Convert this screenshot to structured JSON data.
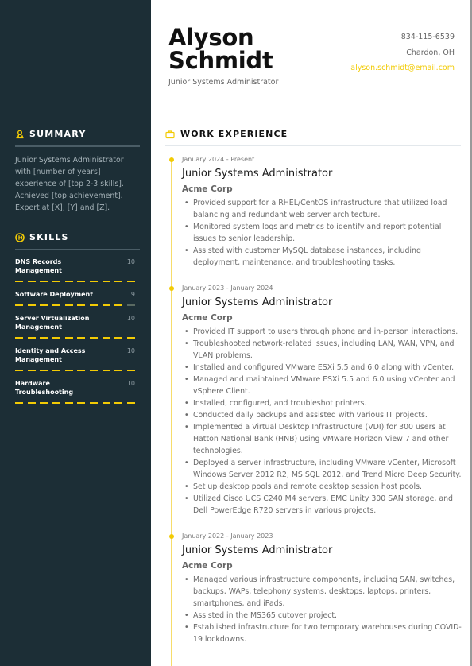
{
  "header": {
    "first_name": "Alyson",
    "last_name": "Schmidt",
    "headline": "Junior Systems Administrator",
    "phone": "834-115-6539",
    "location": "Chardon, OH",
    "email": "alyson.schmidt@email.com"
  },
  "colors": {
    "accent": "#f2cb05",
    "sidebar_bg": "#1c2e36"
  },
  "summary": {
    "title": "SUMMARY",
    "icon": "user-icon",
    "text": "Junior Systems Administrator with [number of years] experience of [top 2-3 skills]. Achieved [top achievement]. Expert at [X], [Y] and [Z]."
  },
  "skills": {
    "title": "SKILLS",
    "icon": "skills-badge-icon",
    "max": 10,
    "items": [
      {
        "name": "DNS Records Management",
        "score": "10",
        "value": 10
      },
      {
        "name": "Software Deployment",
        "score": "9",
        "value": 9
      },
      {
        "name": "Server Virtualization Management",
        "score": "10",
        "value": 10
      },
      {
        "name": "Identity and Access Management",
        "score": "10",
        "value": 10
      },
      {
        "name": "Hardware Troubleshooting",
        "score": "10",
        "value": 10
      }
    ]
  },
  "work": {
    "title": "WORK EXPERIENCE",
    "icon": "briefcase-icon",
    "jobs": [
      {
        "date": "January 2024 - Present",
        "title": "Junior Systems Administrator",
        "company": "Acme Corp",
        "bullets": [
          "Provided support for a RHEL/CentOS infrastructure that utilized load balancing and redundant web server architecture.",
          "Monitored system logs and metrics to identify and report potential issues to senior leadership.",
          "Assisted with customer MySQL database instances, including deployment, maintenance, and troubleshooting tasks."
        ]
      },
      {
        "date": "January 2023 - January 2024",
        "title": "Junior Systems Administrator",
        "company": "Acme Corp",
        "bullets": [
          "Provided IT support to users through phone and in-person interactions.",
          "Troubleshooted network-related issues, including LAN, WAN, VPN, and VLAN problems.",
          "Installed and configured VMware ESXi 5.5 and 6.0 along with vCenter.",
          "Managed and maintained VMware ESXi 5.5 and 6.0 using vCenter and vSphere Client.",
          "Installed, configured, and troubleshot printers.",
          "Conducted daily backups and assisted with various IT projects.",
          "Implemented a Virtual Desktop Infrastructure (VDI) for 300 users at Hatton National Bank (HNB) using VMware Horizon View 7 and other technologies.",
          "Deployed a server infrastructure, including VMware vCenter, Microsoft Windows Server 2012 R2, MS SQL 2012, and Trend Micro Deep Security.",
          "Set up desktop pools and remote desktop session host pools.",
          "Utilized Cisco UCS C240 M4 servers, EMC Unity 300 SAN storage, and Dell PowerEdge R720 servers in various projects."
        ]
      },
      {
        "date": "January 2022 - January 2023",
        "title": "Junior Systems Administrator",
        "company": "Acme Corp",
        "bullets": [
          "Managed various infrastructure components, including SAN, switches, backups, WAPs, telephony systems, desktops, laptops, printers, smartphones, and iPads.",
          "Assisted in the MS365 cutover project.",
          "Established infrastructure for two temporary warehouses during COVID-19 lockdowns."
        ]
      }
    ]
  }
}
